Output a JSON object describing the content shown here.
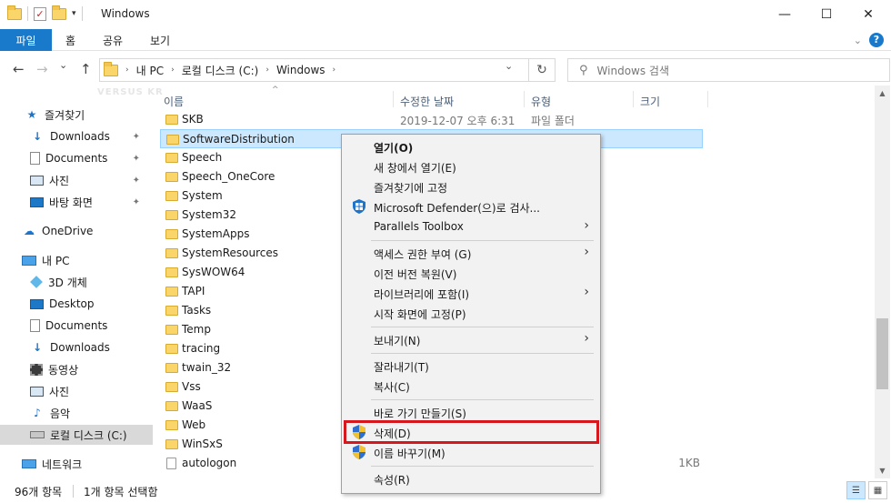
{
  "window": {
    "title": "Windows",
    "minimize": "—",
    "maximize": "☐",
    "close": "✕"
  },
  "ribbon": {
    "file_tab": "파일",
    "tabs": [
      "홈",
      "공유",
      "보기"
    ],
    "help": "?"
  },
  "navigation": {
    "back": "←",
    "forward": "→",
    "recent": "⌄",
    "up": "↑",
    "breadcrumb": [
      "내 PC",
      "로컬 디스크 (C:)",
      "Windows"
    ],
    "refresh": "↻",
    "search_placeholder": "Windows 검색"
  },
  "watermark": "VERSUS KR",
  "sidebar": {
    "items": [
      {
        "label": "즐겨찾기",
        "icon": "star-icon"
      },
      {
        "label": "Downloads",
        "icon": "download-icon",
        "pinned": true
      },
      {
        "label": "Documents",
        "icon": "document-icon",
        "pinned": true
      },
      {
        "label": "사진",
        "icon": "pictures-icon",
        "pinned": true
      },
      {
        "label": "바탕 화면",
        "icon": "desktop-icon",
        "pinned": true
      },
      {
        "label": "OneDrive",
        "icon": "cloud-icon"
      },
      {
        "label": "내 PC",
        "icon": "computer-icon"
      },
      {
        "label": "3D 개체",
        "icon": "3d-objects-icon"
      },
      {
        "label": "Desktop",
        "icon": "desktop-icon"
      },
      {
        "label": "Documents",
        "icon": "document-icon"
      },
      {
        "label": "Downloads",
        "icon": "download-icon"
      },
      {
        "label": "동영상",
        "icon": "video-icon"
      },
      {
        "label": "사진",
        "icon": "pictures-icon"
      },
      {
        "label": "음악",
        "icon": "music-icon"
      },
      {
        "label": "로컬 디스크 (C:)",
        "icon": "drive-icon",
        "selected": true
      },
      {
        "label": "네트워크",
        "icon": "network-icon"
      }
    ],
    "pin_glyph": "📌"
  },
  "filelist": {
    "columns": [
      "이름",
      "수정한 날짜",
      "유형",
      "크기"
    ],
    "rows": [
      {
        "name": "SKB",
        "date": "2019-12-07 오후 6:31",
        "type": "파일 폴더",
        "size": ""
      },
      {
        "name": "SoftwareDistribution",
        "date": "",
        "type": "",
        "size": "",
        "selected": true
      },
      {
        "name": "Speech",
        "date": "",
        "type": "",
        "size": ""
      },
      {
        "name": "Speech_OneCore",
        "date": "",
        "type": "",
        "size": ""
      },
      {
        "name": "System",
        "date": "",
        "type": "",
        "size": ""
      },
      {
        "name": "System32",
        "date": "",
        "type": "",
        "size": ""
      },
      {
        "name": "SystemApps",
        "date": "",
        "type": "",
        "size": ""
      },
      {
        "name": "SystemResources",
        "date": "",
        "type": "",
        "size": ""
      },
      {
        "name": "SysWOW64",
        "date": "",
        "type": "",
        "size": ""
      },
      {
        "name": "TAPI",
        "date": "",
        "type": "",
        "size": ""
      },
      {
        "name": "Tasks",
        "date": "",
        "type": "",
        "size": ""
      },
      {
        "name": "Temp",
        "date": "",
        "type": "",
        "size": ""
      },
      {
        "name": "tracing",
        "date": "",
        "type": "",
        "size": ""
      },
      {
        "name": "twain_32",
        "date": "",
        "type": "",
        "size": ""
      },
      {
        "name": "Vss",
        "date": "",
        "type": "",
        "size": ""
      },
      {
        "name": "WaaS",
        "date": "",
        "type": "",
        "size": ""
      },
      {
        "name": "Web",
        "date": "",
        "type": "",
        "size": ""
      },
      {
        "name": "WinSxS",
        "date": "",
        "type": "",
        "size": ""
      },
      {
        "name": "autologon",
        "date": "",
        "type": "",
        "size": "1KB",
        "file": true
      }
    ]
  },
  "context_menu": {
    "items": [
      {
        "label": "열기(O)",
        "bold": true
      },
      {
        "label": "새 창에서 열기(E)"
      },
      {
        "label": "즐겨찾기에 고정"
      },
      {
        "label": "Microsoft Defender(으)로 검사...",
        "icon": "defender-icon"
      },
      {
        "label": "Parallels Toolbox",
        "submenu": true
      },
      {
        "separator": true
      },
      {
        "label": "액세스 권한 부여 (G)",
        "submenu": true
      },
      {
        "label": "이전 버전 복원(V)"
      },
      {
        "label": "라이브러리에 포함(I)",
        "submenu": true
      },
      {
        "label": "시작 화면에 고정(P)"
      },
      {
        "separator": true
      },
      {
        "label": "보내기(N)",
        "submenu": true
      },
      {
        "separator": true
      },
      {
        "label": "잘라내기(T)"
      },
      {
        "label": "복사(C)"
      },
      {
        "separator": true
      },
      {
        "label": "바로 가기 만들기(S)"
      },
      {
        "label": "삭제(D)",
        "icon": "uac-shield-icon",
        "highlighted": true
      },
      {
        "label": "이름 바꾸기(M)",
        "icon": "uac-shield-icon"
      },
      {
        "separator": true
      },
      {
        "label": "속성(R)"
      }
    ],
    "submenu_glyph": "›",
    "highlight_color": "#d6181e"
  },
  "status": {
    "count": "96개 항목",
    "selection": "1개 항목 선택함"
  },
  "colors": {
    "accent": "#1979ca",
    "selection": "#cce8ff",
    "folder": "#f9d56a"
  }
}
